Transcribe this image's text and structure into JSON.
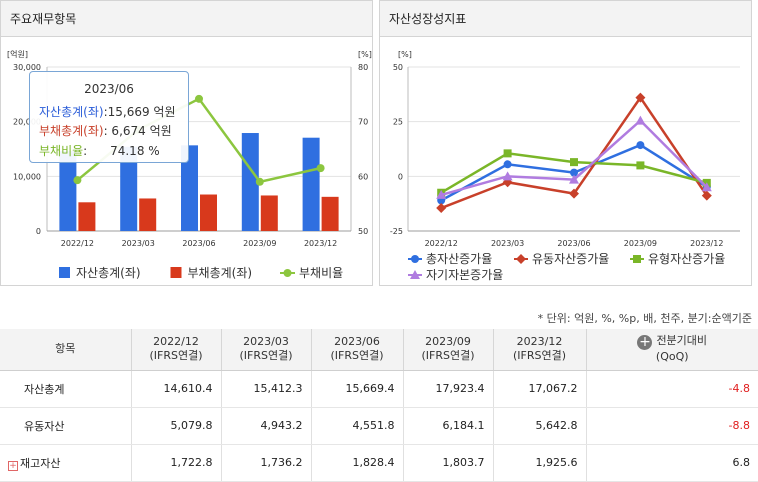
{
  "left_panel": {
    "title": "주요재무항목",
    "tooltip": {
      "date": "2023/06",
      "rows": [
        {
          "label": "자산총계(좌)",
          "value": ":15,669 억원",
          "color": "#2a5cd8"
        },
        {
          "label": "부채총계(좌)",
          "value": ": 6,674 억원",
          "color": "#c8402a"
        },
        {
          "label": "부채비율",
          "value": ":      74.18 %",
          "color": "#7ab628"
        }
      ]
    },
    "chart_data": {
      "type": "bar",
      "categories": [
        "2022/12",
        "2023/03",
        "2023/06",
        "2023/09",
        "2023/12"
      ],
      "series": [
        {
          "name": "자산총계(좌)",
          "kind": "bar",
          "axis": "left",
          "color": "#2f6fe0",
          "values": [
            14610.4,
            15412.3,
            15669.4,
            17923.4,
            17067.2
          ]
        },
        {
          "name": "부채총계(좌)",
          "kind": "bar",
          "axis": "left",
          "color": "#d8391c",
          "values": [
            5250,
            5950,
            6674,
            6500,
            6250
          ]
        },
        {
          "name": "부채비율",
          "kind": "line",
          "axis": "right",
          "color": "#8cc63f",
          "values": [
            59.3,
            68.5,
            74.18,
            59.0,
            61.5
          ]
        }
      ],
      "left_unit": "[억원]",
      "right_unit": "[%]",
      "left_ticks": [
        "30,000",
        "20,000",
        "10,000",
        "0"
      ],
      "right_ticks": [
        "80",
        "70",
        "60",
        "50"
      ],
      "ylim_left": [
        0,
        30000
      ],
      "ylim_right": [
        50,
        80
      ]
    }
  },
  "right_panel": {
    "title": "자산성장성지표",
    "chart_data": {
      "type": "line",
      "categories": [
        "2022/12",
        "2023/03",
        "2023/06",
        "2023/09",
        "2023/12"
      ],
      "series": [
        {
          "name": "총자산증가율",
          "marker": "circle",
          "color": "#2f6fe0",
          "values": [
            -11,
            5.5,
            1.7,
            14.3,
            -4.8
          ]
        },
        {
          "name": "유동자산증가율",
          "marker": "diamond",
          "color": "#c8402a",
          "values": [
            -14.5,
            -2.7,
            -7.9,
            36.0,
            -8.8
          ]
        },
        {
          "name": "유형자산증가율",
          "marker": "square",
          "color": "#7ab628",
          "values": [
            -7.5,
            10.5,
            6.5,
            5.0,
            -3.0
          ]
        },
        {
          "name": "자기자본증가율",
          "marker": "triangle",
          "color": "#b07ce0",
          "values": [
            -8.5,
            0.0,
            -1.5,
            25.5,
            -5.0
          ]
        }
      ],
      "y_unit": "[%]",
      "y_ticks": [
        "50",
        "25",
        "0",
        "-25"
      ],
      "ylim": [
        -25,
        50
      ]
    }
  },
  "unit_note": "* 단위: 억원, %, %p, 배, 천주, 분기:순액기준",
  "table": {
    "header_item": "항목",
    "columns": [
      {
        "period": "2022/12",
        "basis": "(IFRS연결)"
      },
      {
        "period": "2023/03",
        "basis": "(IFRS연결)"
      },
      {
        "period": "2023/06",
        "basis": "(IFRS연결)"
      },
      {
        "period": "2023/09",
        "basis": "(IFRS연결)"
      },
      {
        "period": "2023/12",
        "basis": "(IFRS연결)"
      }
    ],
    "change_header": "전분기대비",
    "change_sub": "(QoQ)",
    "rows": [
      {
        "name": "자산총계",
        "values": [
          "14,610.4",
          "15,412.3",
          "15,669.4",
          "17,923.4",
          "17,067.2"
        ],
        "change": "-4.8"
      },
      {
        "name": "유동자산",
        "values": [
          "5,079.8",
          "4,943.2",
          "4,551.8",
          "6,184.1",
          "5,642.8"
        ],
        "change": "-8.8"
      },
      {
        "name": "재고자산",
        "values": [
          "1,722.8",
          "1,736.2",
          "1,828.4",
          "1,803.7",
          "1,925.6"
        ],
        "change": "6.8"
      }
    ]
  }
}
